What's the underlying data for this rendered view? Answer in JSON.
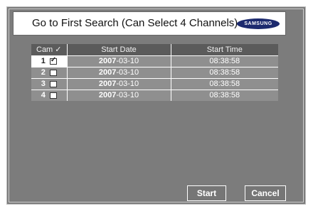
{
  "dialog": {
    "title": "Go to First Search (Can Select 4 Channels)",
    "brand": "SAMSUNG"
  },
  "table": {
    "headers": {
      "cam": "Cam ✓",
      "start_date": "Start Date",
      "start_time": "Start Time"
    },
    "rows": [
      {
        "cam": "1",
        "checked": true,
        "year": "2007",
        "date_rest": "-03-10",
        "time": "08:38:58"
      },
      {
        "cam": "2",
        "checked": false,
        "year": "2007",
        "date_rest": "-03-10",
        "time": "08:38:58"
      },
      {
        "cam": "3",
        "checked": false,
        "year": "2007",
        "date_rest": "-03-10",
        "time": "08:38:58"
      },
      {
        "cam": "4",
        "checked": false,
        "year": "2007",
        "date_rest": "-03-10",
        "time": "08:38:58"
      }
    ]
  },
  "buttons": {
    "start": "Start",
    "cancel": "Cancel"
  },
  "colors": {
    "background": "#7c7c7c",
    "header": "#5b5b5b",
    "row": "#8f8f8f",
    "brand": "#1c2a6e"
  }
}
